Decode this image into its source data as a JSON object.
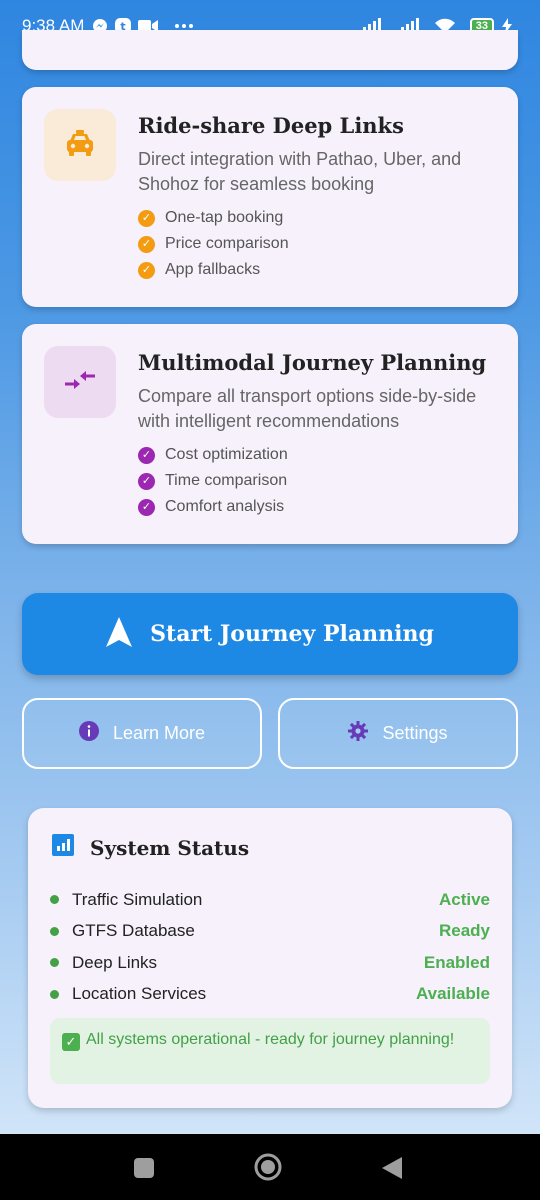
{
  "status_bar": {
    "time": "9:38 AM",
    "battery": "33",
    "icons": [
      "messenger-icon",
      "app-icon",
      "video-icon",
      "more-icon",
      "signal-icon",
      "signal-icon",
      "wifi-icon",
      "battery-icon",
      "charging-icon"
    ]
  },
  "features": [
    {
      "title": "Ride-share Deep Links",
      "description": "Direct integration with Pathao, Uber, and Shohoz for seamless booking",
      "icon": "taxi-icon",
      "accent": "#f39c12",
      "icon_bg": "#faead8",
      "items": [
        "One-tap booking",
        "Price comparison",
        "App fallbacks"
      ]
    },
    {
      "title": "Multimodal Journey Planning",
      "description": "Compare all transport options side-by-side with intelligent recommendations",
      "icon": "compare-arrows-icon",
      "accent": "#9c27b0",
      "icon_bg": "#eddcf1",
      "items": [
        "Cost optimization",
        "Time comparison",
        "Comfort analysis"
      ]
    }
  ],
  "actions": {
    "primary": "Start Journey Planning",
    "learn_more": "Learn More",
    "settings": "Settings"
  },
  "system_status": {
    "title": "System Status",
    "rows": [
      {
        "label": "Traffic Simulation",
        "value": "Active"
      },
      {
        "label": "GTFS Database",
        "value": "Ready"
      },
      {
        "label": "Deep Links",
        "value": "Enabled"
      },
      {
        "label": "Location Services",
        "value": "Available"
      }
    ],
    "message": "All systems operational - ready for journey planning!"
  },
  "colors": {
    "primary": "#1e88e5",
    "success": "#4caf50",
    "purple": "#673ab7"
  }
}
